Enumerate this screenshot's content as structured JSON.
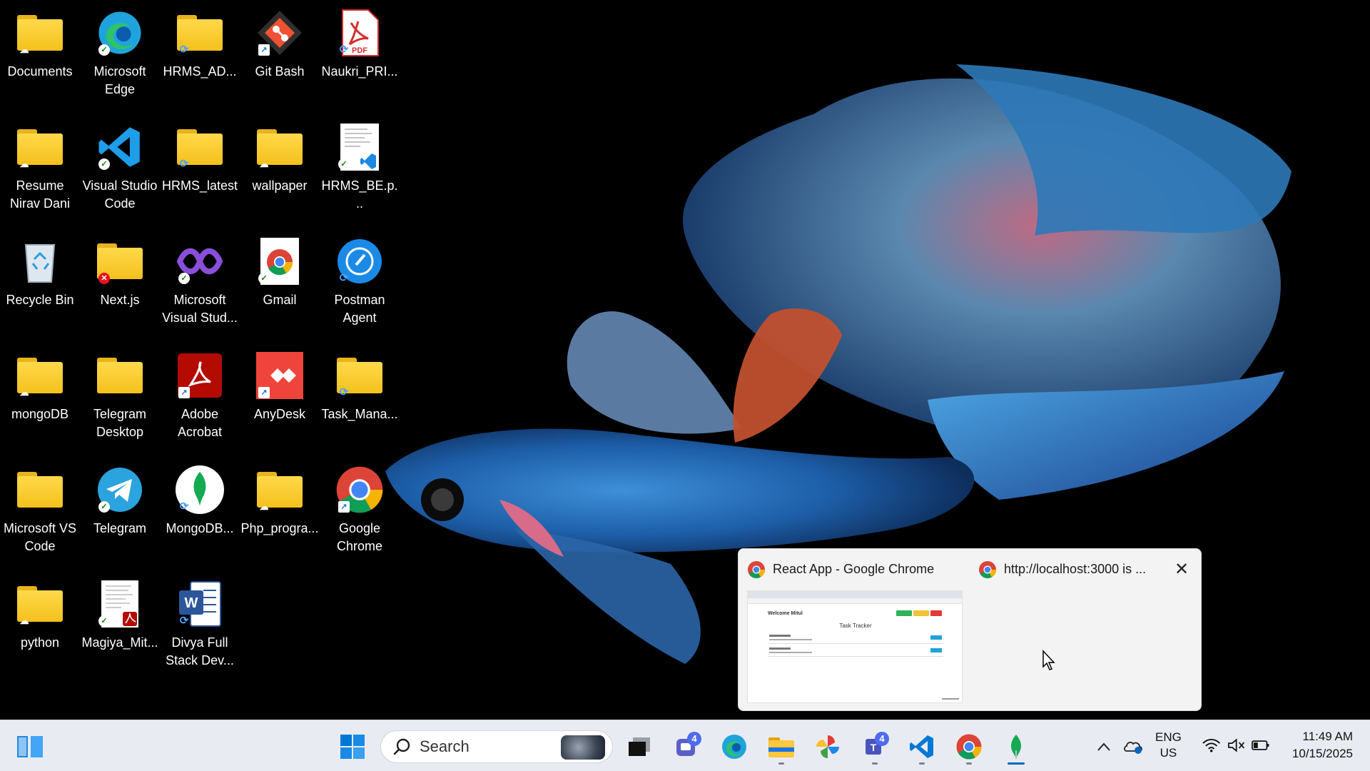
{
  "desktop": {
    "icons": [
      {
        "label": "Documents",
        "icon": "folder-icon",
        "badge": "cloud"
      },
      {
        "label": "Microsoft Edge",
        "icon": "edge-icon",
        "badge": "check"
      },
      {
        "label": "HRMS_AD...",
        "icon": "folder-icon",
        "badge": "sync"
      },
      {
        "label": "Git Bash",
        "icon": "git-bash-icon",
        "badge": "arrow"
      },
      {
        "label": "Naukri_PRI...",
        "icon": "pdf-icon",
        "badge": "sync"
      },
      {
        "label": "Resume Nirav Dani",
        "icon": "folder-icon",
        "badge": "cloud"
      },
      {
        "label": "Visual Studio Code",
        "icon": "vscode-icon",
        "badge": "check"
      },
      {
        "label": "HRMS_latest",
        "icon": "folder-icon",
        "badge": "sync"
      },
      {
        "label": "wallpaper",
        "icon": "folder-icon",
        "badge": "cloud"
      },
      {
        "label": "HRMS_BE.p...",
        "icon": "vscode-project-icon",
        "badge": "check"
      },
      {
        "label": "Recycle Bin",
        "icon": "recycle-bin-icon",
        "badge": ""
      },
      {
        "label": "Next.js",
        "icon": "folder-icon",
        "badge": "err"
      },
      {
        "label": "Microsoft Visual Stud...",
        "icon": "visual-studio-icon",
        "badge": "check"
      },
      {
        "label": "Gmail",
        "icon": "gmail-chrome-icon",
        "badge": "check"
      },
      {
        "label": "Postman Agent",
        "icon": "postman-icon",
        "badge": "sync"
      },
      {
        "label": "mongoDB",
        "icon": "folder-icon",
        "badge": "cloud"
      },
      {
        "label": "Telegram Desktop",
        "icon": "folder-icon",
        "badge": ""
      },
      {
        "label": "Adobe Acrobat",
        "icon": "acrobat-icon",
        "badge": "arrow"
      },
      {
        "label": "AnyDesk",
        "icon": "anydesk-icon",
        "badge": "arrow"
      },
      {
        "label": "Task_Mana...",
        "icon": "folder-icon",
        "badge": "sync"
      },
      {
        "label": "Microsoft VS Code",
        "icon": "folder-icon",
        "badge": ""
      },
      {
        "label": "Telegram",
        "icon": "telegram-icon",
        "badge": "check"
      },
      {
        "label": "MongoDB...",
        "icon": "mongodb-icon",
        "badge": "sync"
      },
      {
        "label": "Php_progra...",
        "icon": "folder-icon",
        "badge": "cloud"
      },
      {
        "label": "Google Chrome",
        "icon": "chrome-icon",
        "badge": "arrow"
      },
      {
        "label": "python",
        "icon": "folder-icon",
        "badge": "cloud"
      },
      {
        "label": "Magiya_Mit...",
        "icon": "pdf-doc-icon",
        "badge": "check"
      },
      {
        "label": "Divya Full Stack Dev...",
        "icon": "word-icon",
        "badge": "sync"
      }
    ]
  },
  "preview": {
    "window1_title": "React App - Google Chrome",
    "window2_title": "http://localhost:3000 is ...",
    "thumb_welcome": "Welcome Mitul",
    "thumb_title": "Task Tracker"
  },
  "taskbar": {
    "search_placeholder": "Search",
    "teams_badge": "4",
    "teams2_badge": "4",
    "lang_line1": "ENG",
    "lang_line2": "US",
    "time": "11:49 AM",
    "date": "10/15/2025"
  },
  "colors": {
    "taskbar_bg": "#e8ecf2",
    "accent": "#0067c0",
    "folder": "#f4c01c"
  }
}
